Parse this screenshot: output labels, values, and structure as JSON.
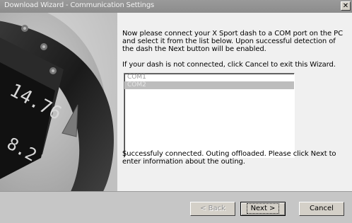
{
  "window": {
    "title": "Download Wizard - Communication Settings",
    "close_glyph": "✕"
  },
  "content": {
    "instruction": "Now please connect your X Sport dash to a COM port on the PC and select it from the list below. Upon successful detection of the dash the Next button will be enabled.",
    "cancel_hint": "If your dash is not connected, click Cancel to exit this Wizard.",
    "ports": [
      {
        "label": "COM1",
        "selected": false
      },
      {
        "label": "COM2",
        "selected": true
      }
    ],
    "status": "Successfuly connected. Outing offloaded. Please click Next to enter information about the outing."
  },
  "dash_display": {
    "top_reading": "14.76",
    "bottom_reading": "8.2"
  },
  "footer": {
    "back_label": "< Back",
    "next_label": "Next >",
    "cancel_label": "Cancel"
  },
  "icons": {
    "close": "close-icon"
  }
}
